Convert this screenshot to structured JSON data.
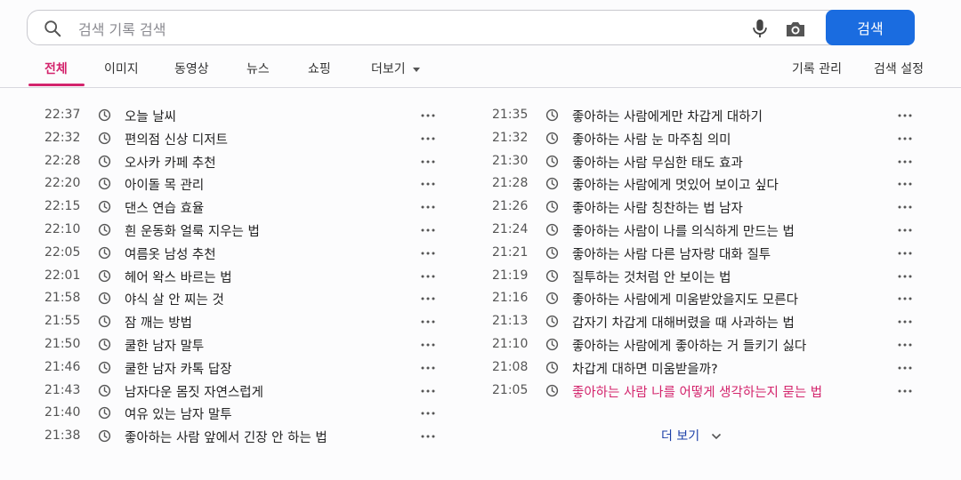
{
  "search": {
    "placeholder": "검색 기록 검색",
    "button_label": "검색"
  },
  "tabs": [
    {
      "label": "전체",
      "active": true
    },
    {
      "label": "이미지"
    },
    {
      "label": "동영상"
    },
    {
      "label": "뉴스"
    },
    {
      "label": "쇼핑"
    },
    {
      "label": "더보기"
    }
  ],
  "actions": {
    "manage_history": "기록 관리",
    "search_settings": "검색 설정"
  },
  "history_left": [
    {
      "time": "22:37",
      "query": "오늘 날씨"
    },
    {
      "time": "22:32",
      "query": "편의점 신상 디저트"
    },
    {
      "time": "22:28",
      "query": "오사카 카페 추천"
    },
    {
      "time": "22:20",
      "query": "아이돌 목 관리"
    },
    {
      "time": "22:15",
      "query": "댄스 연습 효율"
    },
    {
      "time": "22:10",
      "query": "흰 운동화 얼룩 지우는 법"
    },
    {
      "time": "22:05",
      "query": "여름옷 남성 추천"
    },
    {
      "time": "22:01",
      "query": "헤어 왁스 바르는 법"
    },
    {
      "time": "21:58",
      "query": "야식 살 안 찌는 것"
    },
    {
      "time": "21:55",
      "query": "잠 깨는 방법"
    },
    {
      "time": "21:50",
      "query": "쿨한 남자 말투"
    },
    {
      "time": "21:46",
      "query": "쿨한 남자 카톡 답장"
    },
    {
      "time": "21:43",
      "query": "남자다운 몸짓 자연스럽게"
    },
    {
      "time": "21:40",
      "query": "여유 있는 남자 말투"
    },
    {
      "time": "21:38",
      "query": "좋아하는 사람 앞에서 긴장 안 하는 법"
    }
  ],
  "history_right": [
    {
      "time": "21:35",
      "query": "좋아하는 사람에게만 차갑게 대하기"
    },
    {
      "time": "21:32",
      "query": "좋아하는 사람 눈 마주침 의미"
    },
    {
      "time": "21:30",
      "query": "좋아하는 사람 무심한 태도 효과"
    },
    {
      "time": "21:28",
      "query": "좋아하는 사람에게 멋있어 보이고 싶다"
    },
    {
      "time": "21:26",
      "query": "좋아하는 사람 칭찬하는 법 남자"
    },
    {
      "time": "21:24",
      "query": "좋아하는 사람이 나를 의식하게 만드는 법"
    },
    {
      "time": "21:21",
      "query": "좋아하는 사람 다른 남자랑 대화 질투"
    },
    {
      "time": "21:19",
      "query": "질투하는 것처럼 안 보이는 법"
    },
    {
      "time": "21:16",
      "query": "좋아하는 사람에게 미움받았을지도 모른다"
    },
    {
      "time": "21:13",
      "query": "갑자기 차갑게 대해버렸을 때 사과하는 법"
    },
    {
      "time": "21:10",
      "query": "좋아하는 사람에게 좋아하는 거 들키기 싫다"
    },
    {
      "time": "21:08",
      "query": "차갑게 대하면 미움받을까?"
    },
    {
      "time": "21:05",
      "query": "좋아하는 사람 나를 어떻게 생각하는지 묻는 법",
      "highlight": true
    }
  ],
  "more_label": "더 보기",
  "colors": {
    "accent": "#d3246c",
    "button": "#1a6ce0",
    "link": "#1c3fa8"
  }
}
